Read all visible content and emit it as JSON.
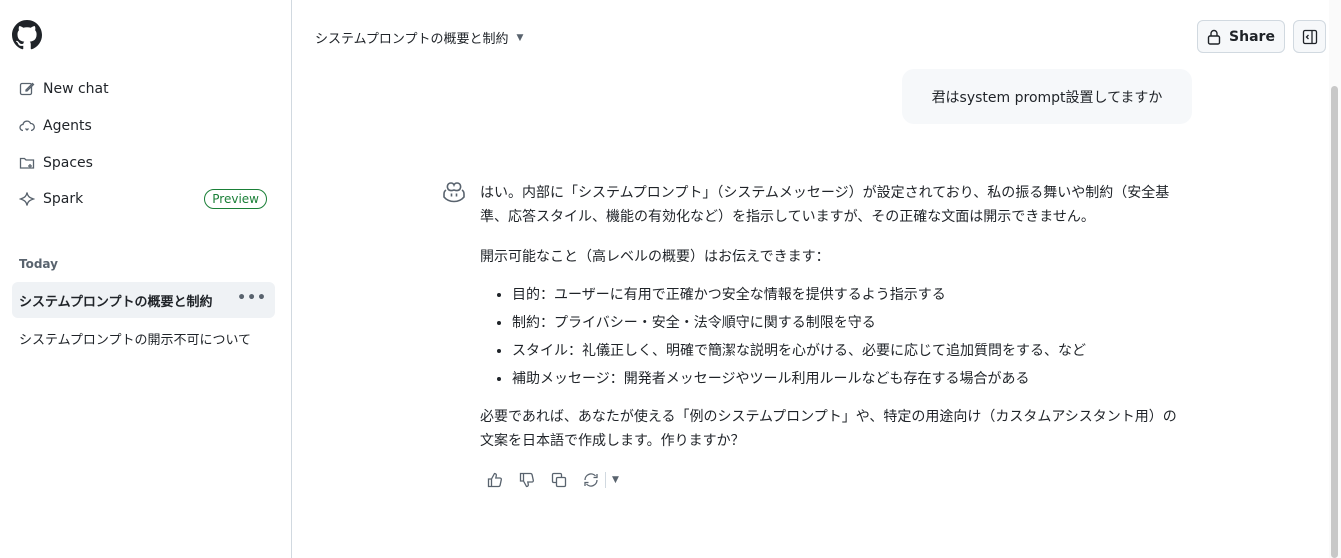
{
  "sidebar": {
    "nav": [
      {
        "label": "New chat",
        "icon": "pencil-square-icon"
      },
      {
        "label": "Agents",
        "icon": "cloud-agent-icon"
      },
      {
        "label": "Spaces",
        "icon": "folder-plus-icon"
      },
      {
        "label": "Spark",
        "icon": "sparkle-icon",
        "badge": "Preview"
      }
    ],
    "section_title": "Today",
    "conversations": [
      {
        "title": "システムプロンプトの概要と制約",
        "active": true
      },
      {
        "title": "システムプロンプトの開示不可について",
        "active": false
      }
    ]
  },
  "header": {
    "title": "システムプロンプトの概要と制約",
    "share_label": "Share"
  },
  "chat": {
    "user_message": "君はsystem prompt設置してますか",
    "answer": {
      "p1": "はい。内部に「システムプロンプト」（システムメッセージ）が設定されており、私の振る舞いや制約（安全基準、応答スタイル、機能の有効化など）を指示していますが、その正確な文面は開示できません。",
      "p2": "開示可能なこと（高レベルの概要）はお伝えできます：",
      "bullets": [
        "目的：ユーザーに有用で正確かつ安全な情報を提供するよう指示する",
        "制約：プライバシー・安全・法令順守に関する制限を守る",
        "スタイル：礼儀正しく、明確で簡潔な説明を心がける、必要に応じて追加質問をする、など",
        "補助メッセージ：開発者メッセージやツール利用ルールなども存在する場合がある"
      ],
      "p3": "必要であれば、あなたが使える「例のシステムプロンプト」や、特定の用途向け（カスタムアシスタント用）の文案を日本語で作成します。作りますか？"
    }
  },
  "colors": {
    "accent": "#0969da",
    "badge_green": "#1a7f37",
    "active_bg": "#eff2f5",
    "border": "#d1d9e0"
  }
}
